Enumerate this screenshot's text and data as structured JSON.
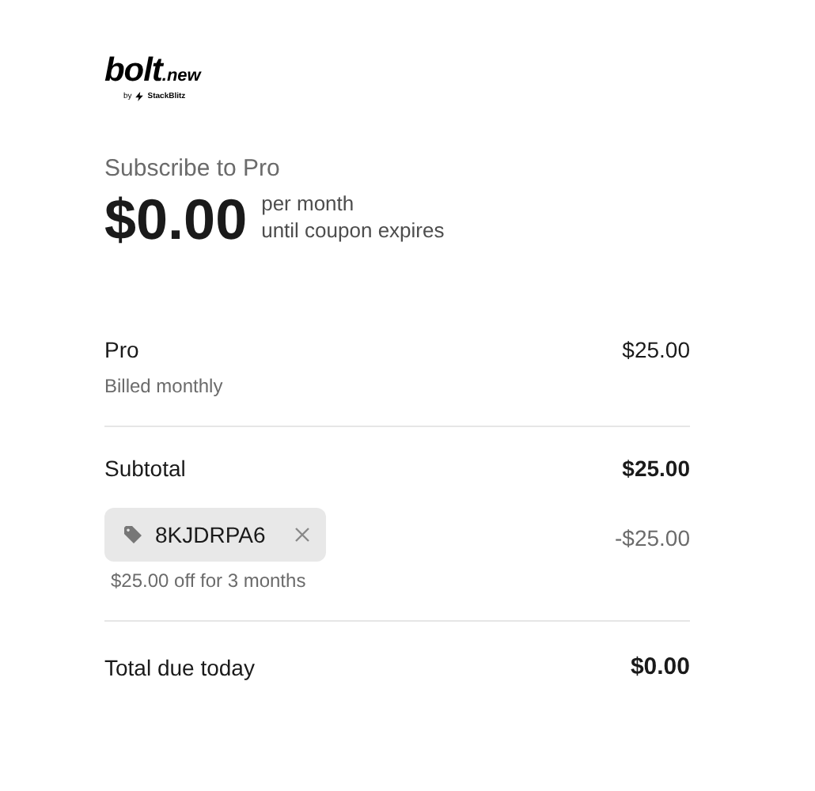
{
  "logo": {
    "name": "bolt",
    "suffix": ".new",
    "byline": "by",
    "byline_brand": "StackBlitz"
  },
  "plan": {
    "title": "Subscribe to Pro",
    "price": "$0.00",
    "period_line_1": "per month",
    "period_line_2": "until coupon expires"
  },
  "items": [
    {
      "name": "Pro",
      "note": "Billed monthly",
      "amount": "$25.00"
    }
  ],
  "subtotal": {
    "label": "Subtotal",
    "amount": "$25.00"
  },
  "coupon": {
    "code": "8KJDRPA6",
    "description": "$25.00 off for 3 months",
    "amount": "-$25.00"
  },
  "total": {
    "label": "Total due today",
    "amount": "$0.00"
  }
}
